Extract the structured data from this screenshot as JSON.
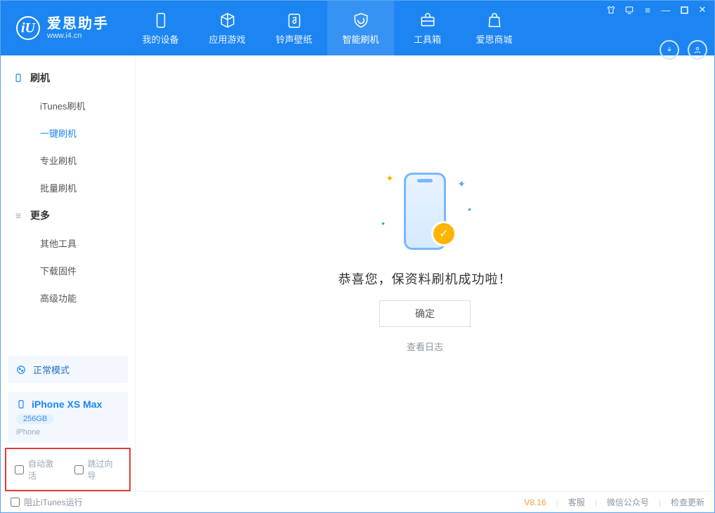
{
  "app": {
    "name_cn": "爱思助手",
    "domain": "www.i4.cn",
    "logo_letter": "iU"
  },
  "tabs": [
    {
      "label": "我的设备",
      "icon": "device"
    },
    {
      "label": "应用游戏",
      "icon": "cube"
    },
    {
      "label": "铃声壁纸",
      "icon": "music"
    },
    {
      "label": "智能刷机",
      "icon": "refresh",
      "active": true
    },
    {
      "label": "工具箱",
      "icon": "toolbox"
    },
    {
      "label": "爱思商城",
      "icon": "bag"
    }
  ],
  "sidebar": {
    "group1_label": "刷机",
    "group1_items": [
      {
        "label": "iTunes刷机"
      },
      {
        "label": "一键刷机",
        "active": true
      },
      {
        "label": "专业刷机"
      },
      {
        "label": "批量刷机"
      }
    ],
    "group2_label": "更多",
    "group2_items": [
      {
        "label": "其他工具"
      },
      {
        "label": "下载固件"
      },
      {
        "label": "高级功能"
      }
    ]
  },
  "mode": {
    "label": "正常模式"
  },
  "device": {
    "name": "iPhone XS Max",
    "capacity": "256GB",
    "type": "iPhone"
  },
  "options": {
    "auto_activate": "自动激活",
    "skip_guide": "跳过向导"
  },
  "main": {
    "success_msg": "恭喜您，保资料刷机成功啦！",
    "ok_label": "确定",
    "log_label": "查看日志"
  },
  "footer": {
    "block_itunes": "阻止iTunes运行",
    "version": "V8.16",
    "links": [
      "客服",
      "微信公众号",
      "检查更新"
    ]
  }
}
